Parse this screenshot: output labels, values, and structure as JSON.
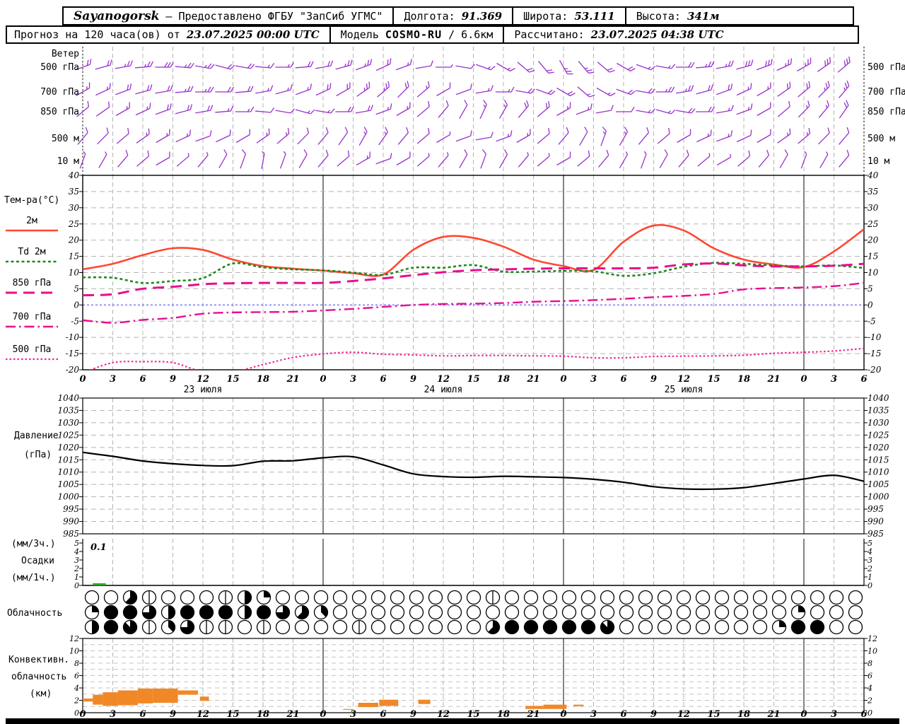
{
  "header": {
    "line1": {
      "station": "Sayanogorsk",
      "sep_dash": "—",
      "provider": "Предоставлено ФГБУ \"ЗапСиб УГМС\"",
      "lon_label": "Долгота:",
      "lon_value": "91.369",
      "lat_label": "Широта:",
      "lat_value": "53.111",
      "alt_label": "Высота:",
      "alt_value": "341м"
    },
    "line2": {
      "forecast_label": "Прогноз на 120 часа(ов) от",
      "run_time": "23.07.2025 00:00 UTC",
      "model_label": "Модель",
      "model_name": "COSMO-RU",
      "model_res": "/ 6.6км",
      "calc_label": "Рассчитано:",
      "calc_time": "23.07.2025 04:38 UTC"
    }
  },
  "panel_labels": {
    "wind_title": "Ветер",
    "wind_levels": [
      "500 гПа",
      "700 гПа",
      "850 гПа",
      "500 м",
      "10 м"
    ],
    "temp_title": "Тем-ра(°C)",
    "temp_legend": [
      {
        "key": "t2m",
        "label": "2м"
      },
      {
        "key": "td2m",
        "label": "Td 2м"
      },
      {
        "key": "t850",
        "label": "850 гПа"
      },
      {
        "key": "t700",
        "label": "700 гПа"
      },
      {
        "key": "t500",
        "label": "500 гПа"
      }
    ],
    "pressure_title": [
      "Давление",
      "(гПа)"
    ],
    "precip_title": [
      "(мм/3ч.)",
      "Осадки",
      "(мм/1ч.)"
    ],
    "precip_annotation": "0.1",
    "cloud_title": "Облачность",
    "conv_title": [
      "Конвективн.",
      "облачность",
      "(км)"
    ]
  },
  "axes": {
    "hours_span": 78,
    "hour_labels": [
      "0",
      "3",
      "6",
      "9",
      "12",
      "15",
      "18",
      "21",
      "0",
      "3",
      "6",
      "9",
      "12",
      "15",
      "18",
      "21",
      "0",
      "3",
      "6",
      "9",
      "12",
      "15",
      "18",
      "21",
      "0",
      "3",
      "6"
    ],
    "day_labels": [
      {
        "hour": 12,
        "label": "23 июля"
      },
      {
        "hour": 36,
        "label": "24 июля"
      },
      {
        "hour": 60,
        "label": "25 июля"
      }
    ],
    "temp_ticks": [
      40,
      35,
      30,
      25,
      20,
      15,
      10,
      5,
      0,
      -5,
      -10,
      -15,
      -20
    ],
    "pressure_ticks": [
      1040,
      1035,
      1030,
      1025,
      1020,
      1015,
      1010,
      1005,
      1000,
      995,
      990,
      985
    ],
    "precip_ticks": [
      5,
      4,
      3,
      2,
      1,
      0
    ],
    "conv_ticks": [
      12,
      10,
      8,
      6,
      4,
      2,
      0
    ]
  },
  "colors": {
    "t2m": "#ff4732",
    "td2m": "#1a8a1a",
    "t850": "#e80e8e",
    "t700": "#e80e8e",
    "t500": "#ee2a96",
    "zero_line": "#5050ff",
    "wind": "#9932cc",
    "pressure": "#000000",
    "conv": "#f08828",
    "precip": "#28a428",
    "grid": "#b4b4b4",
    "day_line": "#303030"
  },
  "chart_data": [
    {
      "type": "line",
      "name": "temperature",
      "unit": "°C",
      "ylim": [
        -20,
        40
      ],
      "x_hours": [
        0,
        3,
        6,
        9,
        12,
        15,
        18,
        21,
        24,
        27,
        30,
        33,
        36,
        39,
        42,
        45,
        48,
        51,
        54,
        57,
        60,
        63,
        66,
        69,
        72,
        75,
        78
      ],
      "series": [
        {
          "key": "t2m",
          "name": "2м",
          "values": [
            11,
            12.7,
            15.4,
            17.5,
            17,
            14,
            12,
            11.2,
            10.6,
            9.8,
            9.4,
            17,
            21,
            20.7,
            18,
            14,
            12,
            10.8,
            19.5,
            24.5,
            23,
            17.5,
            14,
            12.5,
            11.7,
            16.5,
            23.4
          ]
        },
        {
          "key": "td2m",
          "name": "Td 2м",
          "values": [
            8.5,
            8.4,
            6.8,
            7.4,
            8.3,
            12.8,
            11.6,
            11,
            10.7,
            10,
            9.3,
            11.5,
            11.5,
            12.3,
            10.3,
            10.3,
            10.5,
            10.4,
            9,
            9.8,
            11.8,
            13,
            12.7,
            12.2,
            11.9,
            12.2,
            11.4
          ]
        },
        {
          "key": "t850",
          "name": "850 гПа",
          "values": [
            3,
            3.3,
            5,
            5.6,
            6.4,
            6.7,
            6.8,
            6.8,
            6.8,
            7.4,
            8.2,
            9.2,
            10.1,
            10.7,
            11,
            11.2,
            11.3,
            11.3,
            11.3,
            11.5,
            12.5,
            12.8,
            12.2,
            11.9,
            11.9,
            12.1,
            12.7
          ]
        },
        {
          "key": "t700",
          "name": "700 гПа",
          "values": [
            -4.7,
            -5.5,
            -4.6,
            -4,
            -2.7,
            -2.3,
            -2.2,
            -2.1,
            -1.7,
            -1.2,
            -0.6,
            0,
            0.3,
            0.4,
            0.6,
            1,
            1.2,
            1.5,
            1.9,
            2.4,
            2.8,
            3.4,
            4.8,
            5.2,
            5.4,
            5.8,
            6.8
          ]
        },
        {
          "key": "t500",
          "name": "500 гПа",
          "values": [
            -21,
            -17.8,
            -17.5,
            -17.8,
            -20.6,
            -20.6,
            -18.4,
            -16.2,
            -15.1,
            -14.6,
            -15.2,
            -15.4,
            -15.7,
            -15.6,
            -15.6,
            -15.7,
            -15.8,
            -16.3,
            -16.3,
            -15.9,
            -15.8,
            -15.7,
            -15.5,
            -14.9,
            -14.6,
            -14.2,
            -13.4
          ]
        }
      ]
    },
    {
      "type": "line",
      "name": "pressure",
      "unit": "гПа",
      "ylim": [
        985,
        1040
      ],
      "x_hours": [
        0,
        3,
        6,
        9,
        12,
        15,
        18,
        21,
        24,
        27,
        30,
        33,
        36,
        39,
        42,
        45,
        48,
        51,
        54,
        57,
        60,
        63,
        66,
        69,
        72,
        75,
        78
      ],
      "values": [
        1018,
        1016.4,
        1014.5,
        1013.4,
        1012.7,
        1012.6,
        1014.4,
        1014.6,
        1015.8,
        1016.2,
        1012.9,
        1009.3,
        1008.2,
        1007.9,
        1008.3,
        1008.1,
        1007.8,
        1007.1,
        1005.9,
        1004.1,
        1003.2,
        1003.1,
        1003.7,
        1005.4,
        1007.2,
        1008.7,
        1006.3
      ]
    },
    {
      "type": "bar",
      "name": "precipitation",
      "unit": "мм",
      "ylim": [
        0,
        5
      ],
      "bars": [
        {
          "h_start": 1,
          "h_end": 2.3,
          "value": 0.1
        }
      ]
    },
    {
      "type": "table",
      "name": "cloud_okta",
      "rows": [
        {
          "name": "high",
          "okta": [
            0,
            0,
            5,
            1,
            0,
            0,
            0,
            1,
            4,
            2,
            0,
            0,
            0,
            0,
            0,
            0,
            0,
            0,
            0,
            0,
            0,
            1,
            0,
            0,
            0,
            0,
            0,
            0,
            0,
            0,
            0,
            0,
            0,
            0,
            0,
            0,
            0,
            0,
            0,
            0,
            0
          ]
        },
        {
          "name": "middle",
          "okta": [
            2,
            8,
            8,
            6,
            4,
            8,
            8,
            8,
            4,
            8,
            6,
            5,
            3,
            0,
            0,
            0,
            0,
            0,
            0,
            0,
            0,
            0,
            0,
            0,
            0,
            0,
            0,
            0,
            0,
            0,
            0,
            0,
            0,
            0,
            0,
            0,
            0,
            2,
            0,
            0,
            0
          ]
        },
        {
          "name": "low",
          "okta": [
            4,
            8,
            7,
            1,
            3,
            6,
            1,
            1,
            0,
            1,
            0,
            0,
            0,
            0,
            1,
            0,
            0,
            0,
            0,
            0,
            0,
            5,
            8,
            8,
            8,
            8,
            8,
            7,
            0,
            0,
            0,
            0,
            0,
            0,
            0,
            0,
            2,
            8,
            8,
            0,
            0
          ]
        }
      ]
    },
    {
      "type": "bar",
      "name": "convective_cloud_km",
      "ylim": [
        0,
        12
      ],
      "segments": [
        [
          0,
          1,
          1.8,
          2.3
        ],
        [
          1,
          2,
          1.3,
          2.9
        ],
        [
          2,
          3.5,
          1.1,
          3.3
        ],
        [
          3.5,
          5.5,
          1.2,
          3.6
        ],
        [
          5.5,
          7,
          1.5,
          3.9
        ],
        [
          7,
          9.5,
          1.6,
          3.9
        ],
        [
          9.5,
          11.5,
          2.9,
          3.6
        ],
        [
          11.7,
          12.6,
          1.9,
          2.6
        ],
        [
          26,
          27,
          0.45,
          0.6
        ],
        [
          27.5,
          29.5,
          0.9,
          1.6
        ],
        [
          29.6,
          31.5,
          1.1,
          2.1
        ],
        [
          33.5,
          34.7,
          1.4,
          2.1
        ],
        [
          44.2,
          46,
          0.6,
          1.1
        ],
        [
          46,
          48.3,
          0.6,
          1.3
        ],
        [
          49,
          50,
          1.05,
          1.3
        ]
      ]
    },
    {
      "type": "scatter",
      "name": "wind_barbs",
      "step_hours": 2,
      "levels": [
        {
          "level": "500 гПа",
          "dir": [
            250,
            255,
            260,
            265,
            270,
            275,
            280,
            285,
            280,
            275,
            270,
            265,
            260,
            255,
            250,
            245,
            250,
            260,
            270,
            280,
            290,
            300,
            310,
            320,
            330,
            320,
            310,
            300,
            290,
            280,
            270,
            265,
            260,
            255,
            250,
            245,
            240,
            235,
            230
          ],
          "spd": [
            10,
            10,
            12.5,
            12.5,
            15,
            12.5,
            12.5,
            10,
            10,
            7.5,
            7.5,
            10,
            10,
            12.5,
            12.5,
            10,
            7.5,
            5,
            2.5,
            5,
            7.5,
            7.5,
            10,
            10,
            12.5,
            12.5,
            10,
            10,
            7.5,
            7.5,
            10,
            12.5,
            12.5,
            15,
            15,
            12.5,
            12.5,
            15,
            15
          ]
        },
        {
          "level": "700 гПа",
          "dir": [
            240,
            245,
            250,
            255,
            260,
            265,
            270,
            270,
            265,
            260,
            255,
            250,
            245,
            240,
            235,
            230,
            225,
            230,
            240,
            250,
            260,
            270,
            280,
            290,
            300,
            310,
            300,
            290,
            280,
            270,
            260,
            255,
            250,
            245,
            240,
            235,
            230,
            225,
            220
          ],
          "spd": [
            7.5,
            7.5,
            10,
            10,
            10,
            12.5,
            12.5,
            10,
            10,
            7.5,
            7.5,
            7.5,
            10,
            10,
            12.5,
            12.5,
            10,
            7.5,
            5,
            5,
            7.5,
            7.5,
            10,
            10,
            10,
            7.5,
            7.5,
            10,
            10,
            12.5,
            12.5,
            10,
            10,
            7.5,
            7.5,
            10,
            10,
            12.5,
            12.5
          ]
        },
        {
          "level": "850 гПа",
          "dir": [
            230,
            235,
            240,
            245,
            250,
            255,
            260,
            265,
            270,
            275,
            280,
            285,
            280,
            270,
            260,
            250,
            240,
            230,
            220,
            210,
            205,
            210,
            220,
            230,
            240,
            250,
            260,
            270,
            280,
            285,
            280,
            270,
            260,
            250,
            240,
            230,
            225,
            220,
            215
          ],
          "spd": [
            5,
            5,
            7.5,
            7.5,
            10,
            10,
            10,
            7.5,
            7.5,
            5,
            5,
            7.5,
            7.5,
            10,
            10,
            7.5,
            7.5,
            5,
            5,
            5,
            7.5,
            7.5,
            10,
            10,
            7.5,
            7.5,
            5,
            5,
            7.5,
            7.5,
            10,
            10,
            7.5,
            7.5,
            5,
            5,
            7.5,
            7.5,
            10
          ]
        },
        {
          "level": "500 м",
          "dir": [
            220,
            225,
            230,
            235,
            240,
            245,
            250,
            245,
            240,
            235,
            230,
            225,
            220,
            215,
            210,
            215,
            220,
            230,
            240,
            250,
            260,
            250,
            240,
            230,
            220,
            210,
            200,
            210,
            220,
            230,
            240,
            245,
            250,
            245,
            240,
            235,
            230,
            225,
            220
          ],
          "spd": [
            5,
            5,
            5,
            7.5,
            7.5,
            7.5,
            5,
            5,
            5,
            7.5,
            7.5,
            5,
            5,
            5,
            7.5,
            7.5,
            5,
            5,
            2.5,
            5,
            5,
            7.5,
            7.5,
            5,
            5,
            5,
            7.5,
            7.5,
            5,
            5,
            5,
            7.5,
            7.5,
            5,
            5,
            7.5,
            7.5,
            5,
            5
          ]
        },
        {
          "level": "10 м",
          "dir": [
            200,
            210,
            220,
            230,
            240,
            230,
            220,
            210,
            200,
            190,
            200,
            210,
            220,
            230,
            240,
            250,
            240,
            230,
            220,
            210,
            200,
            210,
            220,
            230,
            240,
            230,
            220,
            210,
            200,
            210,
            220,
            230,
            240,
            230,
            220,
            210,
            200,
            210,
            220
          ],
          "spd": [
            2.5,
            2.5,
            5,
            5,
            5,
            2.5,
            2.5,
            5,
            5,
            2.5,
            2.5,
            5,
            5,
            5,
            7.5,
            5,
            5,
            2.5,
            2.5,
            5,
            5,
            5,
            2.5,
            2.5,
            5,
            5,
            5,
            2.5,
            2.5,
            5,
            5,
            2.5,
            2.5,
            5,
            5,
            5,
            2.5,
            2.5,
            5
          ]
        }
      ]
    }
  ]
}
